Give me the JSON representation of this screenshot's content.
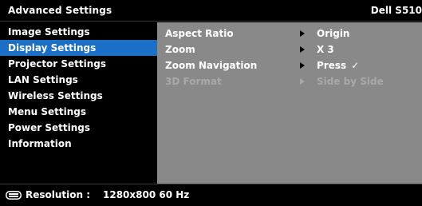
{
  "header": {
    "title": "Advanced Settings",
    "model": "Dell S510"
  },
  "sidebar": {
    "items": [
      {
        "label": "Image Settings",
        "selected": false
      },
      {
        "label": "Display Settings",
        "selected": true
      },
      {
        "label": "Projector Settings",
        "selected": false
      },
      {
        "label": "LAN Settings",
        "selected": false
      },
      {
        "label": "Wireless Settings",
        "selected": false
      },
      {
        "label": "Menu Settings",
        "selected": false
      },
      {
        "label": "Power Settings",
        "selected": false
      },
      {
        "label": "Information",
        "selected": false
      }
    ]
  },
  "panel": {
    "rows": [
      {
        "label": "Aspect Ratio",
        "value": "Origin",
        "enabled": true
      },
      {
        "label": "Zoom",
        "value": "X 3",
        "enabled": true
      },
      {
        "label": "Zoom Navigation",
        "value": "Press",
        "check": "✓",
        "enabled": true
      },
      {
        "label": "3D Format",
        "value": "Side by Side",
        "enabled": false
      }
    ]
  },
  "footer": {
    "resolution_label": "Resolution :",
    "resolution_value": "1280x800 60 Hz",
    "icon": "resolution-icon"
  },
  "colors": {
    "selected": "#1b6fc6",
    "panel": "#898989",
    "background": "#000000",
    "disabled_text": "#a9a9a9"
  }
}
